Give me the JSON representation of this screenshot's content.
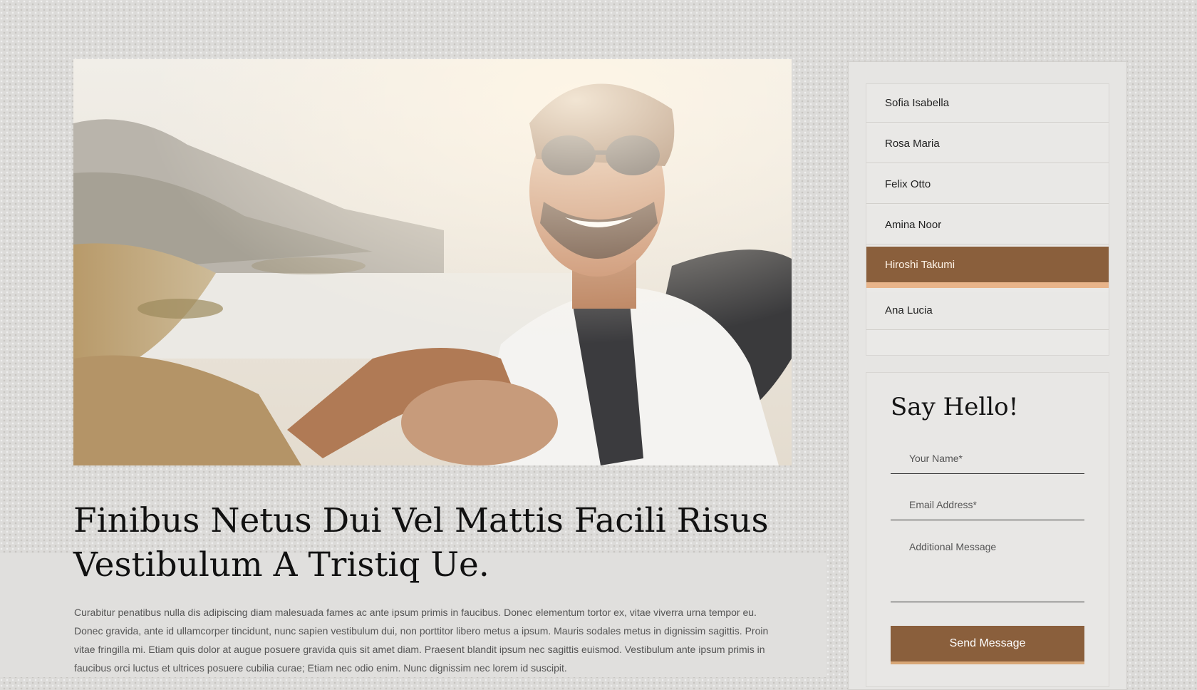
{
  "article": {
    "headline": "Finibus Netus Dui Vel Mattis Facili Risus Vestibulum A Tristiq Ue.",
    "body": "Curabitur penatibus nulla dis adipiscing diam malesuada fames ac ante ipsum primis in faucibus. Donec elementum tortor ex, vitae viverra urna tempor eu. Donec gravida, ante id ullamcorper tincidunt, nunc sapien vestibulum dui, non porttitor libero metus a ipsum. Mauris sodales metus in dignissim sagittis. Proin vitae fringilla mi. Etiam quis dolor at augue posuere gravida quis sit amet diam. Praesent blandit ipsum nec sagittis euismod. Vestibulum ante ipsum primis in faucibus orci luctus et ultrices posuere cubilia curae; Etiam nec odio enim. Nunc dignissim nec lorem id suscipit."
  },
  "sidebar": {
    "tabs": [
      {
        "label": "Sofia Isabella"
      },
      {
        "label": "Rosa Maria"
      },
      {
        "label": "Felix Otto"
      },
      {
        "label": "Amina Noor"
      },
      {
        "label": "Hiroshi Takumi"
      },
      {
        "label": "Ana Lucia"
      }
    ],
    "active_tab": "Hiroshi Takumi"
  },
  "contact_form": {
    "title": "Say Hello!",
    "name_placeholder": "Your Name*",
    "email_placeholder": "Email Address*",
    "message_placeholder": "Additional Message",
    "submit_label": "Send Message"
  },
  "colors": {
    "accent": "#8a5f3c",
    "accent_highlight": "#e8b48a",
    "background": "#dcdbd9"
  }
}
